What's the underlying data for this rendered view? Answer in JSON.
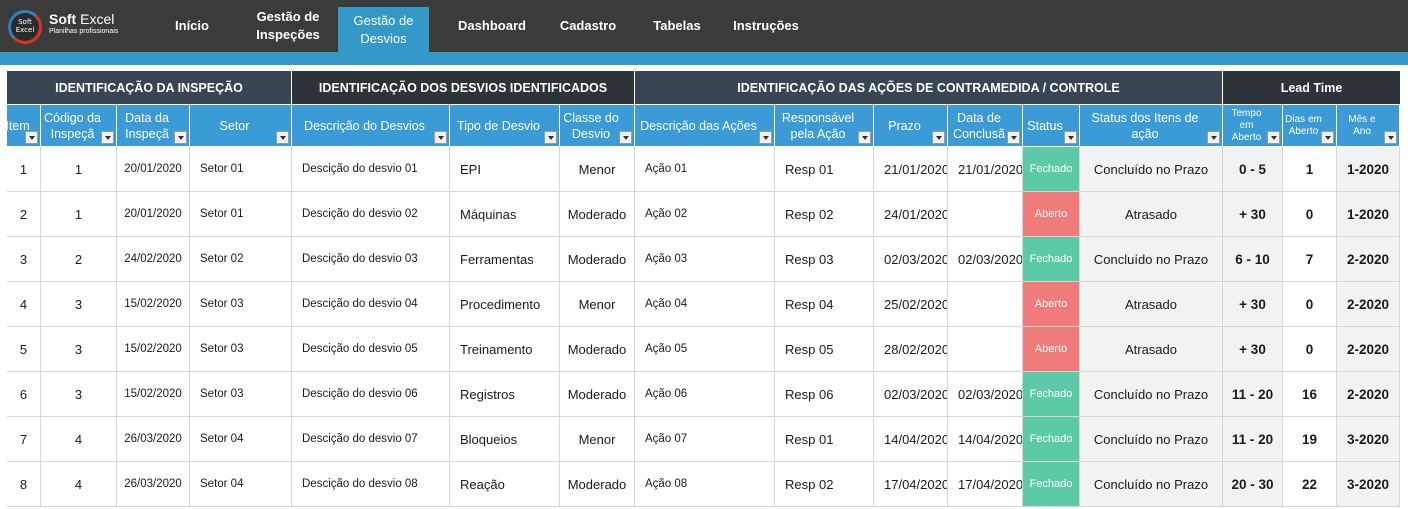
{
  "brand": {
    "logo_text_top": "Soft",
    "logo_text_bottom": "Excel",
    "title_bold": "Soft",
    "title_light": " Excel",
    "subtitle": "Planilhas profissionais"
  },
  "nav": [
    {
      "label": "Início",
      "active": false
    },
    {
      "label": "Gestão de Inspeções",
      "active": false
    },
    {
      "label": "Gestão de Desvios",
      "active": true
    },
    {
      "label": "Dashboard",
      "active": false
    },
    {
      "label": "Cadastro",
      "active": false
    },
    {
      "label": "Tabelas",
      "active": false
    },
    {
      "label": "Instruções",
      "active": false
    }
  ],
  "groups": [
    "IDENTIFICAÇÃO DA INSPEÇÃO",
    "IDENTIFICAÇÃO DOS DESVIOS IDENTIFICADOS",
    "IDENTIFICAÇÃO DAS AÇÕES DE CONTRAMEDIDA / CONTROLE",
    "Lead Time"
  ],
  "columns": [
    "Item",
    "Código da Inspeçã",
    "Data da Inspeçã",
    "Setor",
    "Descrição do Desvios",
    "Tipo de Desvio",
    "Classe do Desvio",
    "Descrição das Ações",
    "Responsável pela Ação",
    "Prazo",
    "Data de Conclusã",
    "Status",
    "Status dos Itens de ação",
    "Tempo em Aberto",
    "Dias em Aberto",
    "Mês e Ano"
  ],
  "rows": [
    [
      "1",
      "1",
      "20/01/2020",
      "Setor 01",
      "Descição do desvio 01",
      "EPI",
      "Menor",
      "Ação 01",
      "Resp 01",
      "21/01/2020",
      "21/01/2020",
      "Fechado",
      "Concluído no Prazo",
      "0 - 5",
      "1",
      "1-2020"
    ],
    [
      "2",
      "1",
      "20/01/2020",
      "Setor 01",
      "Descição do desvio 02",
      "Máquinas",
      "Moderado",
      "Ação 02",
      "Resp 02",
      "24/01/2020",
      "",
      "Aberto",
      "Atrasado",
      "+ 30",
      "0",
      "1-2020"
    ],
    [
      "3",
      "2",
      "24/02/2020",
      "Setor 02",
      "Descição do desvio 03",
      "Ferramentas",
      "Moderado",
      "Ação 03",
      "Resp 03",
      "02/03/2020",
      "02/03/2020",
      "Fechado",
      "Concluído no Prazo",
      "6 - 10",
      "7",
      "2-2020"
    ],
    [
      "4",
      "3",
      "15/02/2020",
      "Setor 03",
      "Descição do desvio 04",
      "Procedimento",
      "Menor",
      "Ação 04",
      "Resp 04",
      "25/02/2020",
      "",
      "Aberto",
      "Atrasado",
      "+ 30",
      "0",
      "2-2020"
    ],
    [
      "5",
      "3",
      "15/02/2020",
      "Setor 03",
      "Descição do desvio 05",
      "Treinamento",
      "Moderado",
      "Ação 05",
      "Resp 05",
      "28/02/2020",
      "",
      "Aberto",
      "Atrasado",
      "+ 30",
      "0",
      "2-2020"
    ],
    [
      "6",
      "3",
      "15/02/2020",
      "Setor 03",
      "Descição do desvio 06",
      "Registros",
      "Moderado",
      "Ação 06",
      "Resp 06",
      "02/03/2020",
      "02/03/2020",
      "Fechado",
      "Concluído no Prazo",
      "11 - 20",
      "16",
      "2-2020"
    ],
    [
      "7",
      "4",
      "26/03/2020",
      "Setor 04",
      "Descição do desvio 07",
      "Bloqueios",
      "Menor",
      "Ação 07",
      "Resp 01",
      "14/04/2020",
      "14/04/2020",
      "Fechado",
      "Concluído no Prazo",
      "11 - 20",
      "19",
      "3-2020"
    ],
    [
      "8",
      "4",
      "26/03/2020",
      "Setor 04",
      "Descição do desvio 08",
      "Reação",
      "Moderado",
      "Ação 08",
      "Resp 02",
      "17/04/2020",
      "17/04/2020",
      "Fechado",
      "Concluído no Prazo",
      "20 - 30",
      "22",
      "3-2020"
    ]
  ],
  "colors": {
    "topbar": "#3b3b3b",
    "accent": "#3498c8",
    "header_blue": "#3a9bd6",
    "status_closed": "#5cc9a7",
    "status_open": "#f07b7b"
  }
}
